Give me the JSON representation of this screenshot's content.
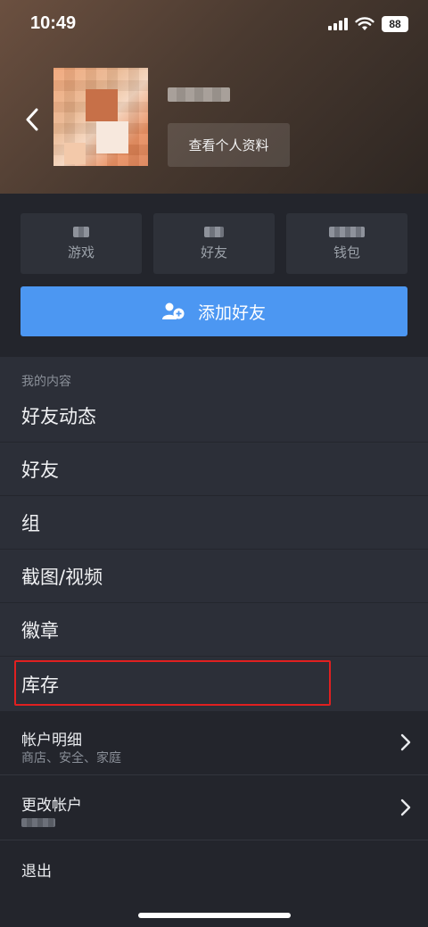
{
  "status_bar": {
    "time": "10:49",
    "battery": "88"
  },
  "profile": {
    "view_profile_label": "查看个人资料"
  },
  "stats": [
    {
      "label": "游戏"
    },
    {
      "label": "好友"
    },
    {
      "label": "钱包"
    }
  ],
  "add_friend_label": "添加好友",
  "my_content": {
    "section_label": "我的内容",
    "items": [
      "好友动态",
      "好友",
      "组",
      "截图/视频",
      "徽章",
      "库存"
    ]
  },
  "account_details": {
    "title": "帐户明细",
    "subtitle": "商店、安全、家庭"
  },
  "change_account": {
    "title": "更改帐户"
  },
  "logout_label": "退出",
  "colors": {
    "accent_button": "#4c97f2",
    "highlight_border": "#e02020",
    "background": "#2c2f38"
  }
}
